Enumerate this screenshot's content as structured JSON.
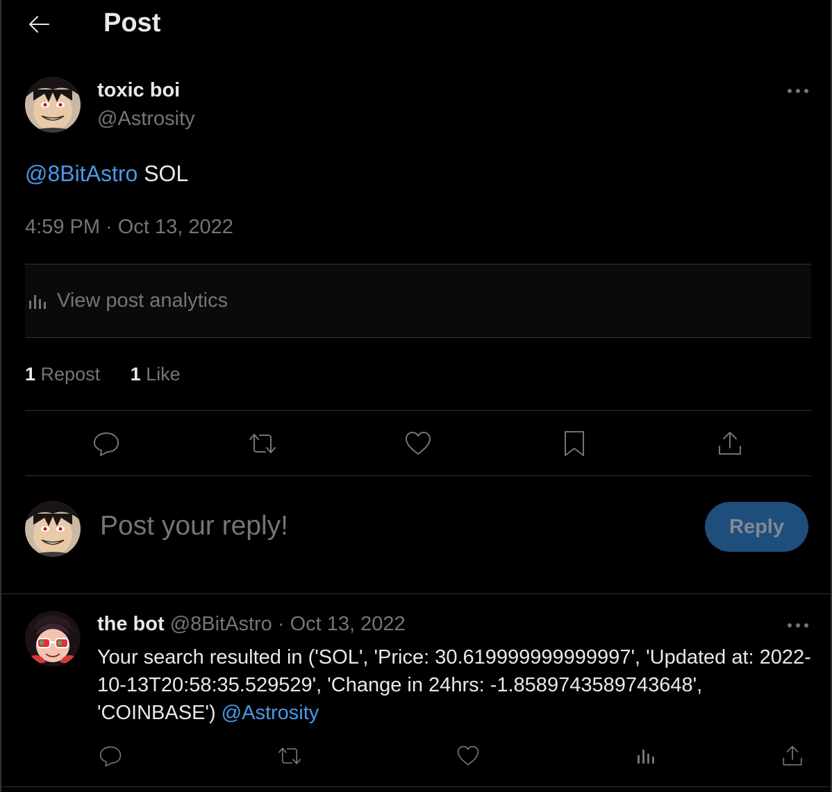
{
  "header": {
    "title": "Post",
    "back_icon": "arrow-left-icon"
  },
  "post": {
    "author_name": "toxic boi",
    "author_handle": "@Astrosity",
    "mention": "@8BitAstro",
    "text": " SOL",
    "timestamp": "4:59 PM · Oct 13, 2022",
    "analytics_label": "View post analytics",
    "stats": [
      {
        "count": "1",
        "label": "Repost"
      },
      {
        "count": "1",
        "label": "Like"
      }
    ],
    "actions": [
      "reply-icon",
      "repost-icon",
      "like-icon",
      "bookmark-icon",
      "share-icon"
    ]
  },
  "composer": {
    "placeholder": "Post your reply!",
    "reply_button": "Reply"
  },
  "reply": {
    "author_name": "the bot",
    "author_handle": "@8BitAstro",
    "date": "Oct 13, 2022",
    "separator": "·",
    "text": "Your search resulted in ('SOL', 'Price: 30.619999999999997', 'Updated at: 2022-10-13T20:58:35.529529', 'Change in 24hrs: -1.8589743589743648', 'COINBASE') ",
    "mention": "@Astrosity",
    "actions": [
      "reply-icon",
      "repost-icon",
      "like-icon",
      "analytics-icon",
      "share-icon"
    ]
  },
  "colors": {
    "background": "#000000",
    "text": "#e7e9ea",
    "muted": "#71767b",
    "link": "#4a99e9",
    "reply_button_bg": "#1e4e7c",
    "divider": "#2f3336"
  }
}
